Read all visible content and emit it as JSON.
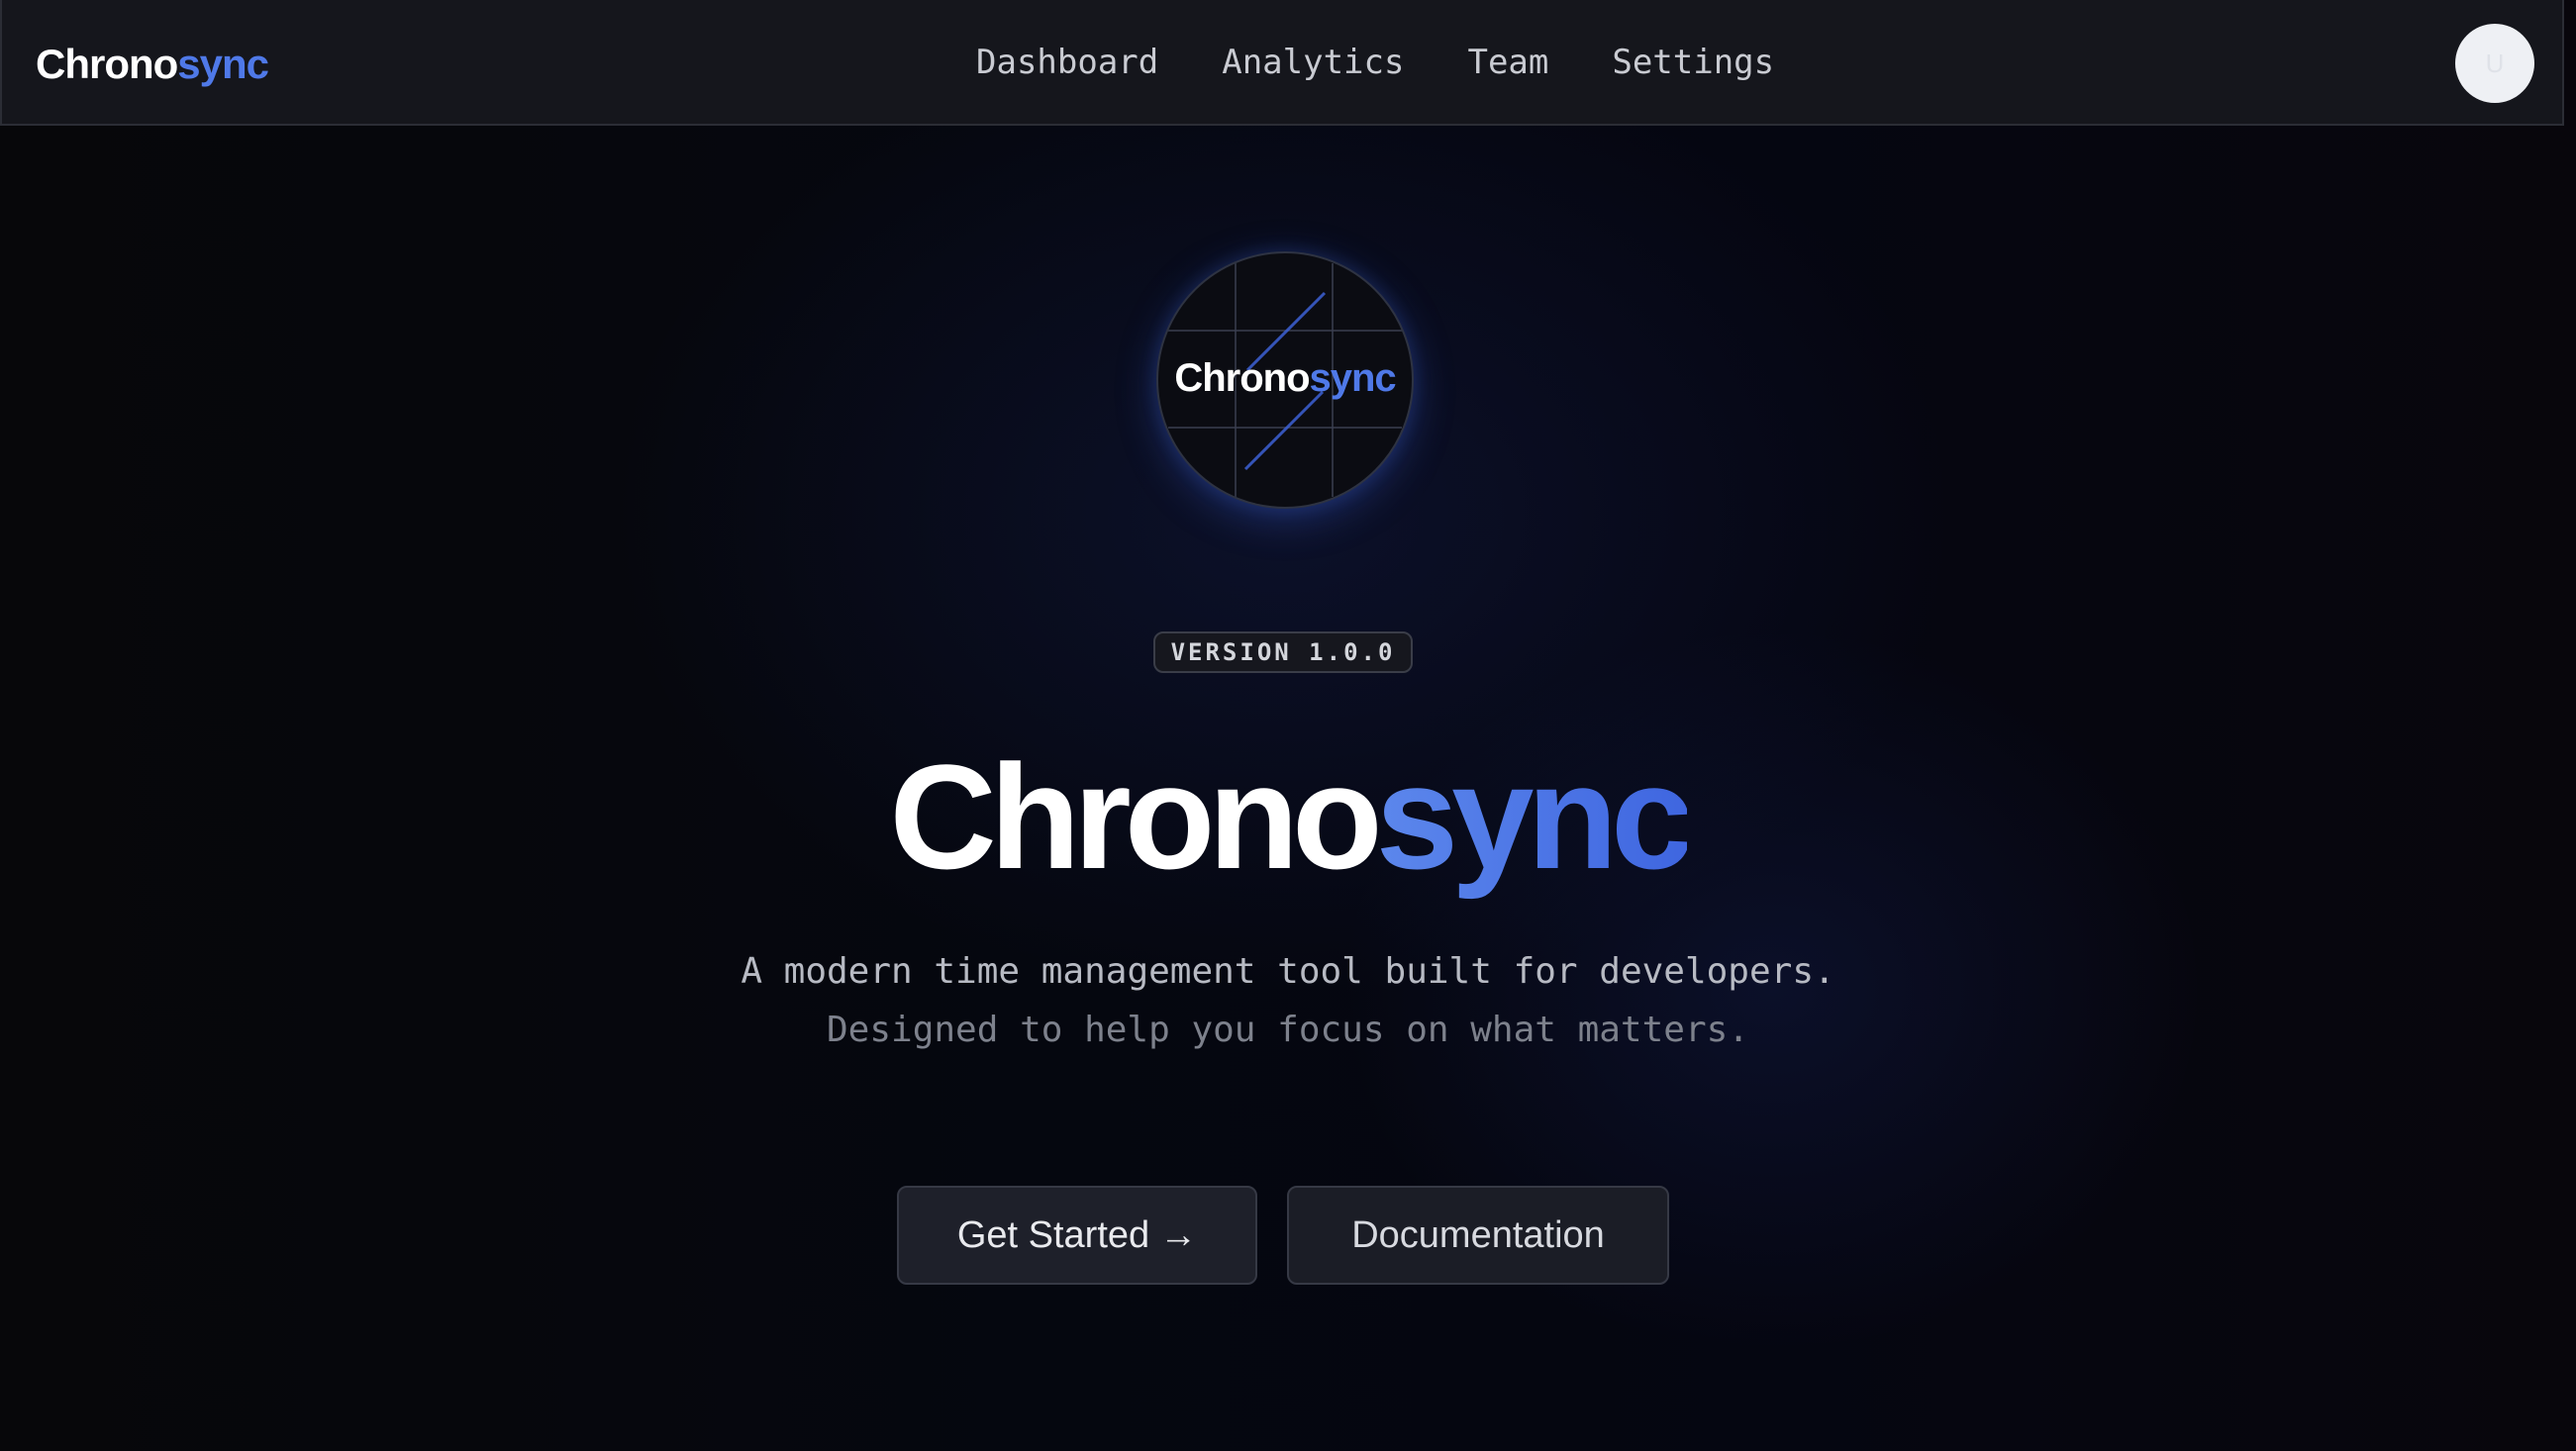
{
  "nav": {
    "brand": {
      "part1": "Chrono",
      "part2": "sync"
    },
    "links": [
      "Dashboard",
      "Analytics",
      "Team",
      "Settings"
    ],
    "avatar_initial": "U"
  },
  "logo_badge": {
    "part1": "Chrono",
    "part2": "sync"
  },
  "version_badge": "VERSION 1.0.0",
  "hero": {
    "title_part1": "Chrono",
    "title_part2": "sync",
    "tagline_line1": "A modern time management tool built for developers.",
    "tagline_line2": "Designed to help you focus on what matters."
  },
  "buttons": {
    "get_started": "Get Started",
    "get_started_arrow": "→",
    "documentation": "Documentation"
  },
  "colors": {
    "accent_blue": "#4f79e8",
    "background": "#05060b",
    "nav_background": "#15161c",
    "button_background": "#1b1d26"
  },
  "icons": {
    "arrow": "arrow-right-icon"
  }
}
